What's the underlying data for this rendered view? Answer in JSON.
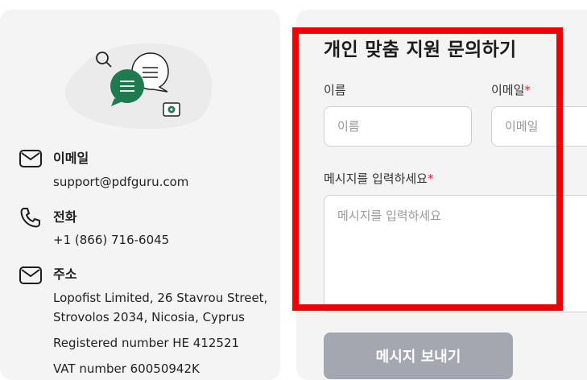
{
  "contact": {
    "email": {
      "title": "이메일",
      "value": "support@pdfguru.com"
    },
    "phone": {
      "title": "전화",
      "value": "+1 (866) 716-6045"
    },
    "address": {
      "title": "주소",
      "line1": "Lopofist Limited, 26 Stavrou Street,",
      "line2": "Strovolos 2034, Nicosia, Cyprus",
      "registered": "Registered number HE 412521",
      "vat": "VAT number 60050942K"
    }
  },
  "form": {
    "title": "개인 맞춤 지원 문의하기",
    "name_label": "이름",
    "name_placeholder": "이름",
    "email_label": "이메일",
    "email_placeholder": "이메일",
    "required_mark": "*",
    "message_label": "메시지를 입력하세요",
    "message_placeholder": "메시지를 입력하세요",
    "send_label": "메시지 보내기"
  },
  "colors": {
    "accent_green": "#1e7a4f",
    "highlight": "#ee0000",
    "button_disabled": "#a3a8b0",
    "required": "#e0242a"
  }
}
